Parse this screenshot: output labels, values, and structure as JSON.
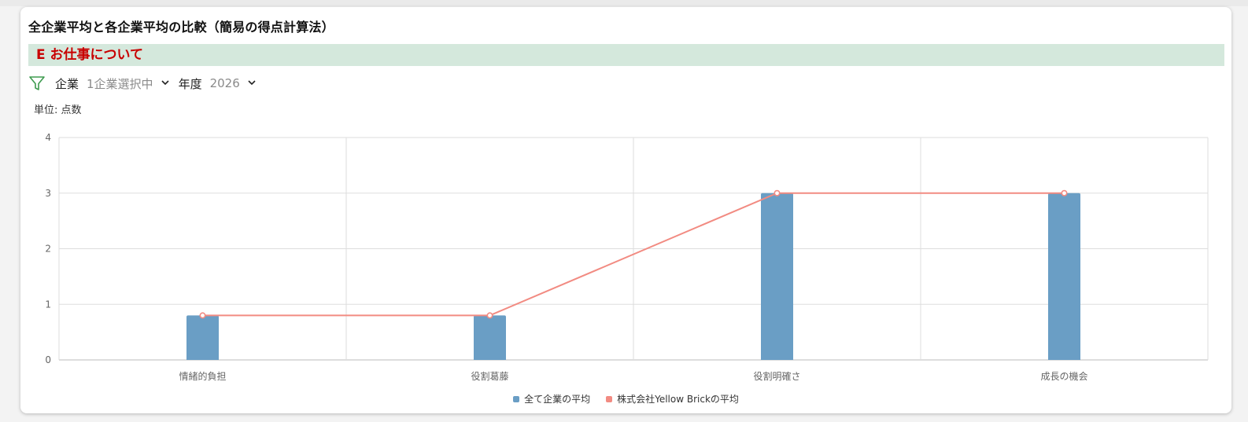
{
  "title": "全企業平均と各企業平均の比較（簡易の得点計算法）",
  "section_label": "E お仕事について",
  "filters": {
    "company_label": "企業",
    "company_value": "1企業選択中",
    "year_label": "年度",
    "year_value": "2026",
    "filter_icon": "filter-icon",
    "chevron_icon": "chevron-down-icon"
  },
  "unit_label": "単位: 点数",
  "colors": {
    "bar": "#6a9ec5",
    "line": "#f28b82",
    "section_bg": "#d4e8dc",
    "section_text": "#c80000"
  },
  "chart_data": {
    "type": "bar",
    "categories": [
      "情緒的負担",
      "役割葛藤",
      "役割明確さ",
      "成長の機会"
    ],
    "series": [
      {
        "name": "全て企業の平均",
        "type": "bar",
        "values": [
          0.8,
          0.8,
          3.0,
          3.0
        ]
      },
      {
        "name": "株式会社Yellow Brickの平均",
        "type": "line",
        "values": [
          0.8,
          0.8,
          3.0,
          3.0
        ]
      }
    ],
    "ylim": [
      0,
      4
    ],
    "yticks": [
      "0",
      "1",
      "2",
      "3",
      "4"
    ],
    "grid": true,
    "legend_position": "bottom"
  }
}
